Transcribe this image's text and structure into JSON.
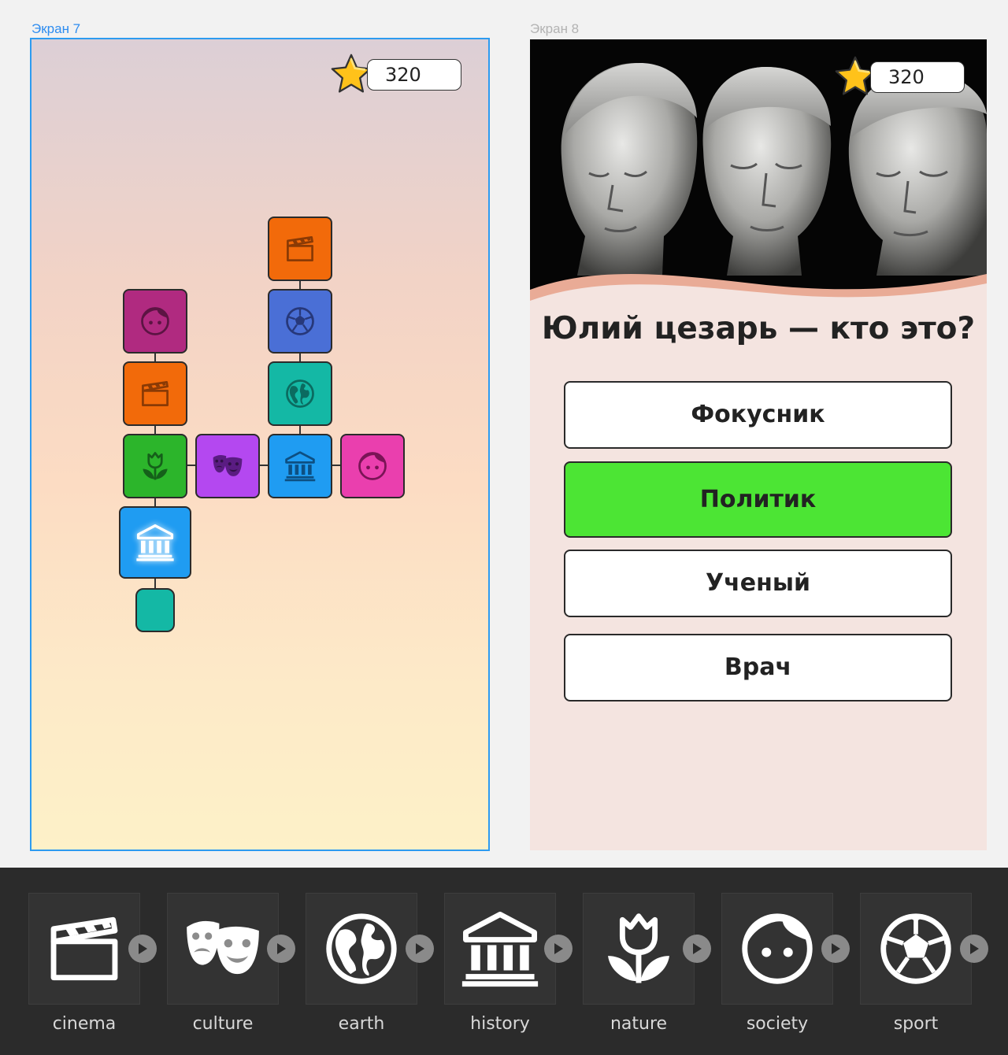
{
  "screens": {
    "screen7": {
      "label": "Экран 7",
      "score": "320"
    },
    "screen8": {
      "label": "Экран 8",
      "score": "320",
      "question": "Юлий цезарь — кто это?",
      "answers": [
        {
          "label": "Фокусник",
          "selected": false
        },
        {
          "label": "Политик",
          "selected": true
        },
        {
          "label": "Ученый",
          "selected": false
        },
        {
          "label": "Врач",
          "selected": false
        }
      ]
    }
  },
  "tiles": [
    {
      "category": "cinema",
      "color": "#f26a0a",
      "icon": "clapper-icon"
    },
    {
      "category": "sport",
      "color": "#4a6fd6",
      "icon": "soccer-ball-icon"
    },
    {
      "category": "earth",
      "color": "#14b8a5",
      "icon": "globe-icon"
    },
    {
      "category": "society",
      "color": "#b02a80",
      "icon": "face-icon"
    },
    {
      "category": "cinema",
      "color": "#f26a0a",
      "icon": "clapper-icon"
    },
    {
      "category": "nature",
      "color": "#2cb52b",
      "icon": "tulip-icon"
    },
    {
      "category": "culture",
      "color": "#b448f0",
      "icon": "theater-masks-icon"
    },
    {
      "category": "history",
      "color": "#1f9cf2",
      "icon": "museum-icon"
    },
    {
      "category": "society",
      "color": "#ea3fae",
      "icon": "face-icon"
    },
    {
      "category": "history",
      "color": "#1f9cf2",
      "icon": "museum-icon",
      "highlighted": true
    },
    {
      "category": "earth",
      "color": "#14b8a5",
      "icon": "",
      "locked": true
    }
  ],
  "assets": [
    {
      "label": "cinema",
      "icon": "clapper-icon"
    },
    {
      "label": "culture",
      "icon": "theater-masks-icon"
    },
    {
      "label": "earth",
      "icon": "globe-icon"
    },
    {
      "label": "history",
      "icon": "museum-icon"
    },
    {
      "label": "nature",
      "icon": "tulip-icon"
    },
    {
      "label": "society",
      "icon": "face-icon"
    },
    {
      "label": "sport",
      "icon": "soccer-ball-icon"
    }
  ],
  "colors": {
    "selection": "#2d9bf0",
    "correct_answer": "#4ce534",
    "panel": "#2b2b2b"
  }
}
